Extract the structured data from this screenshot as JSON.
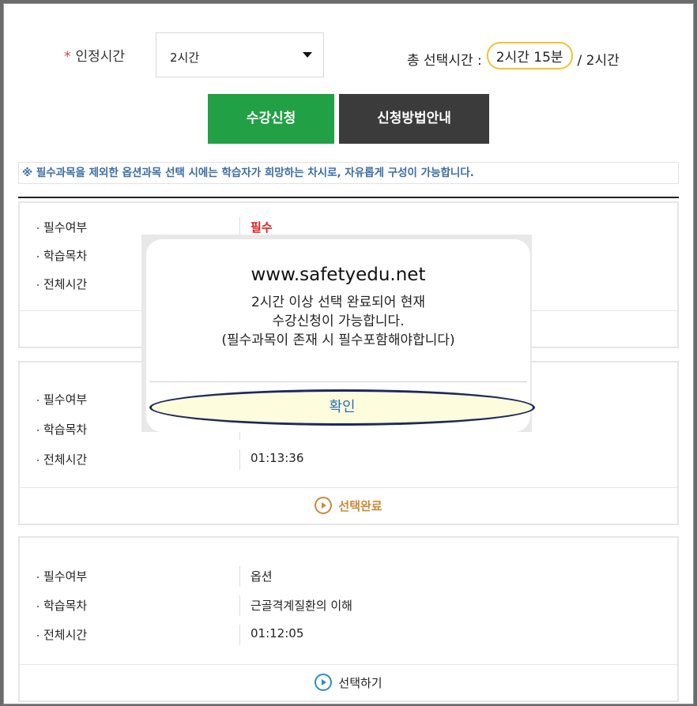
{
  "form": {
    "required_star": "*",
    "label": "인정시간",
    "select_value": "2시간",
    "total_label": "총 선택시간 :",
    "total_selected": "2시간 15분",
    "total_slash": "/",
    "total_required": "2시간"
  },
  "buttons": {
    "apply": "수강신청",
    "guide": "신청방법안내"
  },
  "notice": "※ 필수과목을 제외한 옵션과목 선택 시에는 학습자가 희망하는 차시로, 자유롭게 구성이 가능합니다.",
  "field_labels": {
    "required": "필수여부",
    "chapter": "학습목차",
    "total_time": "전체시간"
  },
  "cards": [
    {
      "required": "필수",
      "chapter": "",
      "total_time": "",
      "action": ""
    },
    {
      "required": "",
      "chapter": "",
      "total_time": "01:13:36",
      "action": "선택완료"
    },
    {
      "required": "옵션",
      "chapter": "근골격계질환의 이해",
      "total_time": "01:12:05",
      "action": "선택하기"
    }
  ],
  "dialog": {
    "site": "www.safetyedu.net",
    "line1": "2시간 이상 선택 완료되어 현재",
    "line2": "수강신청이 가능합니다.",
    "line3": "(필수과목이 존재 시 필수포함해야합니다)",
    "confirm": "확인"
  },
  "colors": {
    "apply_button": "#21a045",
    "guide_button": "#3b3b3b",
    "notice_text": "#3a6ea5",
    "required_value": "#e02020",
    "highlight_ring": "#f1c232",
    "confirm_ring": "#1c2a5a",
    "confirm_fill": "#fdfdde"
  },
  "icons": {
    "card_action": "play-circle-icon",
    "select_caret": "caret-down-icon"
  }
}
